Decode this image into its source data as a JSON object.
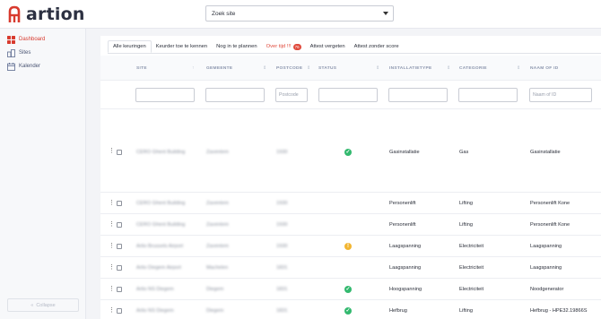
{
  "brand": {
    "name": "artion",
    "accent": "#d83a2e"
  },
  "site_select": {
    "value": "Zoek site"
  },
  "sidebar": {
    "items": [
      {
        "label": "Dashboard",
        "icon": "grid-icon",
        "active": true
      },
      {
        "label": "Sites",
        "icon": "buildings-icon",
        "active": false
      },
      {
        "label": "Kalender",
        "icon": "calendar-icon",
        "active": false
      }
    ],
    "collapse_label": "Collapse"
  },
  "tabs": [
    {
      "label": "Alle keuringen",
      "active": true
    },
    {
      "label": "Keurder toe te kennen"
    },
    {
      "label": "Nog in te plannen"
    },
    {
      "label": "Over tijd !!!",
      "badge": "76",
      "highlight": true
    },
    {
      "label": "Attest vergeten"
    },
    {
      "label": "Attest zonder score"
    }
  ],
  "columns": [
    "SITE",
    "GEMEENTE",
    "POSTCODE",
    "STATUS",
    "INSTALLATIETYPE",
    "CATEGORIE",
    "NAAM OF ID"
  ],
  "filters": {
    "postcode_placeholder": "Postcode",
    "naam_placeholder": "Naam of ID"
  },
  "rows": [
    {
      "site": "CERO Ghent Building",
      "gemeente": "Zaventem",
      "postcode": "1930",
      "status": "ok",
      "status_glyph": "✓",
      "type": "Gasinstallatie",
      "categorie": "Gas",
      "naam": "Gasinstallatie"
    },
    {
      "site": "CERO Ghent Building",
      "gemeente": "Zaventem",
      "postcode": "1930",
      "status": "",
      "status_glyph": "",
      "type": "Personenlift",
      "categorie": "Lifting",
      "naam": "Personenlift Kone"
    },
    {
      "site": "CERO Ghent Building",
      "gemeente": "Zaventem",
      "postcode": "1930",
      "status": "",
      "status_glyph": "",
      "type": "Personenlift",
      "categorie": "Lifting",
      "naam": "Personenlift Kone"
    },
    {
      "site": "Artio Brussels Airport",
      "gemeente": "Zaventem",
      "postcode": "1930",
      "status": "warn",
      "status_glyph": "!",
      "type": "Laagspanning",
      "categorie": "Electriciteit",
      "naam": "Laagspanning"
    },
    {
      "site": "Artio Diegem Airport",
      "gemeente": "Machelen",
      "postcode": "1831",
      "status": "",
      "status_glyph": "",
      "type": "Laagspanning",
      "categorie": "Electriciteit",
      "naam": "Laagspanning"
    },
    {
      "site": "Artio NS Diegem",
      "gemeente": "Diegem",
      "postcode": "1831",
      "status": "ok",
      "status_glyph": "✓",
      "type": "Hoogspanning",
      "categorie": "Electriciteit",
      "naam": "Noodgenerator"
    },
    {
      "site": "Artio NS Diegem",
      "gemeente": "Diegem",
      "postcode": "1831",
      "status": "ok",
      "status_glyph": "✓",
      "type": "Hefbrug",
      "categorie": "Lifting",
      "naam": "Hefbrug - HPE32.19866S"
    }
  ]
}
